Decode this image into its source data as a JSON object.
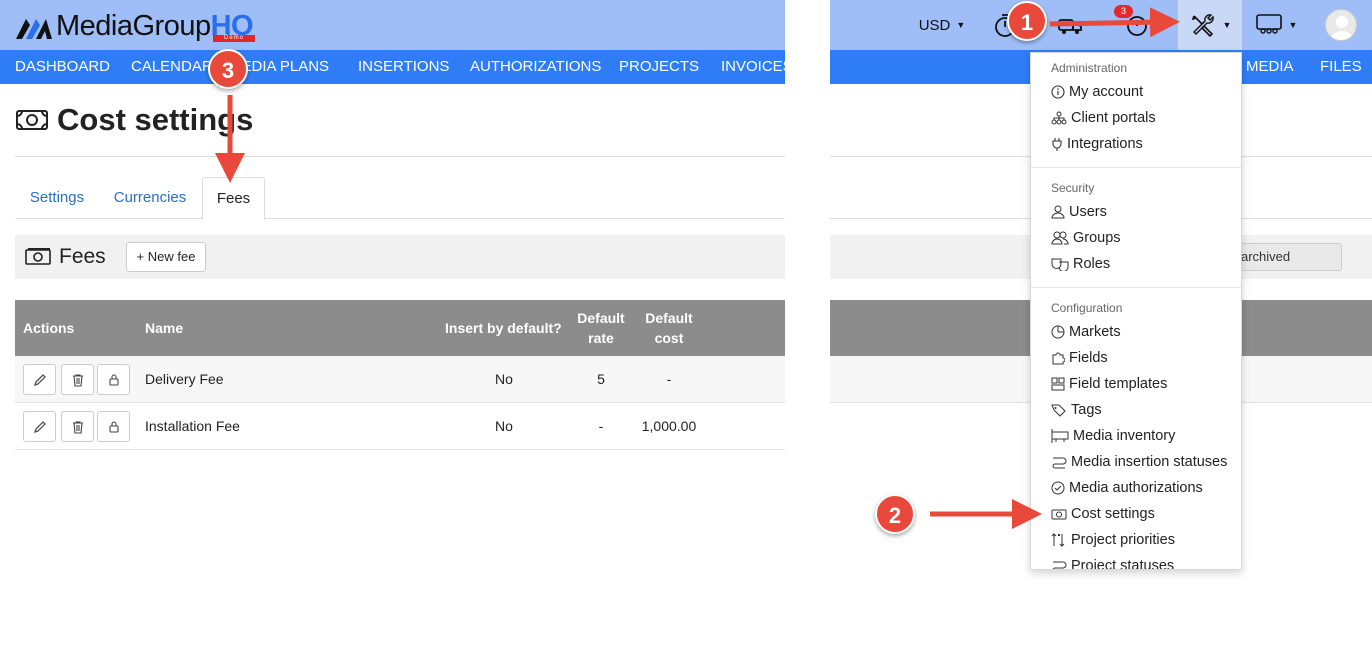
{
  "header": {
    "logo_main": "MediaGroup",
    "logo_hq": "HQ",
    "logo_demo": "Demo",
    "currency": "USD",
    "notification_count": "3",
    "accent_color": "#2f7df6"
  },
  "nav": {
    "items": [
      "DASHBOARD",
      "CALENDAR",
      "MEDIA PLANS",
      "INSERTIONS",
      "AUTHORIZATIONS",
      "PROJECTS",
      "INVOICES",
      "MEDIA",
      "FILES"
    ]
  },
  "page": {
    "title": "Cost settings",
    "tabs": [
      "Settings",
      "Currencies",
      "Fees"
    ],
    "active_tab": "Fees",
    "section_title": "Fees",
    "new_fee_label": "+ New fee",
    "archived_label": "archived"
  },
  "table": {
    "headers": [
      "Actions",
      "Name",
      "Insert by default?",
      "Default rate",
      "Default cost"
    ],
    "rows": [
      {
        "name": "Delivery Fee",
        "insert_default": "No",
        "rate": "5",
        "cost": "-"
      },
      {
        "name": "Installation Fee",
        "insert_default": "No",
        "rate": "-",
        "cost": "1,000.00"
      }
    ]
  },
  "dropdown": {
    "sections": [
      {
        "header": "Administration",
        "items": [
          "My account",
          "Client portals",
          "Integrations"
        ]
      },
      {
        "header": "Security",
        "items": [
          "Users",
          "Groups",
          "Roles"
        ]
      },
      {
        "header": "Configuration",
        "items": [
          "Markets",
          "Fields",
          "Field templates",
          "Tags",
          "Media inventory",
          "Media insertion statuses",
          "Media authorizations",
          "Cost settings",
          "Project priorities",
          "Project statuses"
        ]
      }
    ]
  },
  "annotations": [
    "1",
    "2",
    "3"
  ]
}
